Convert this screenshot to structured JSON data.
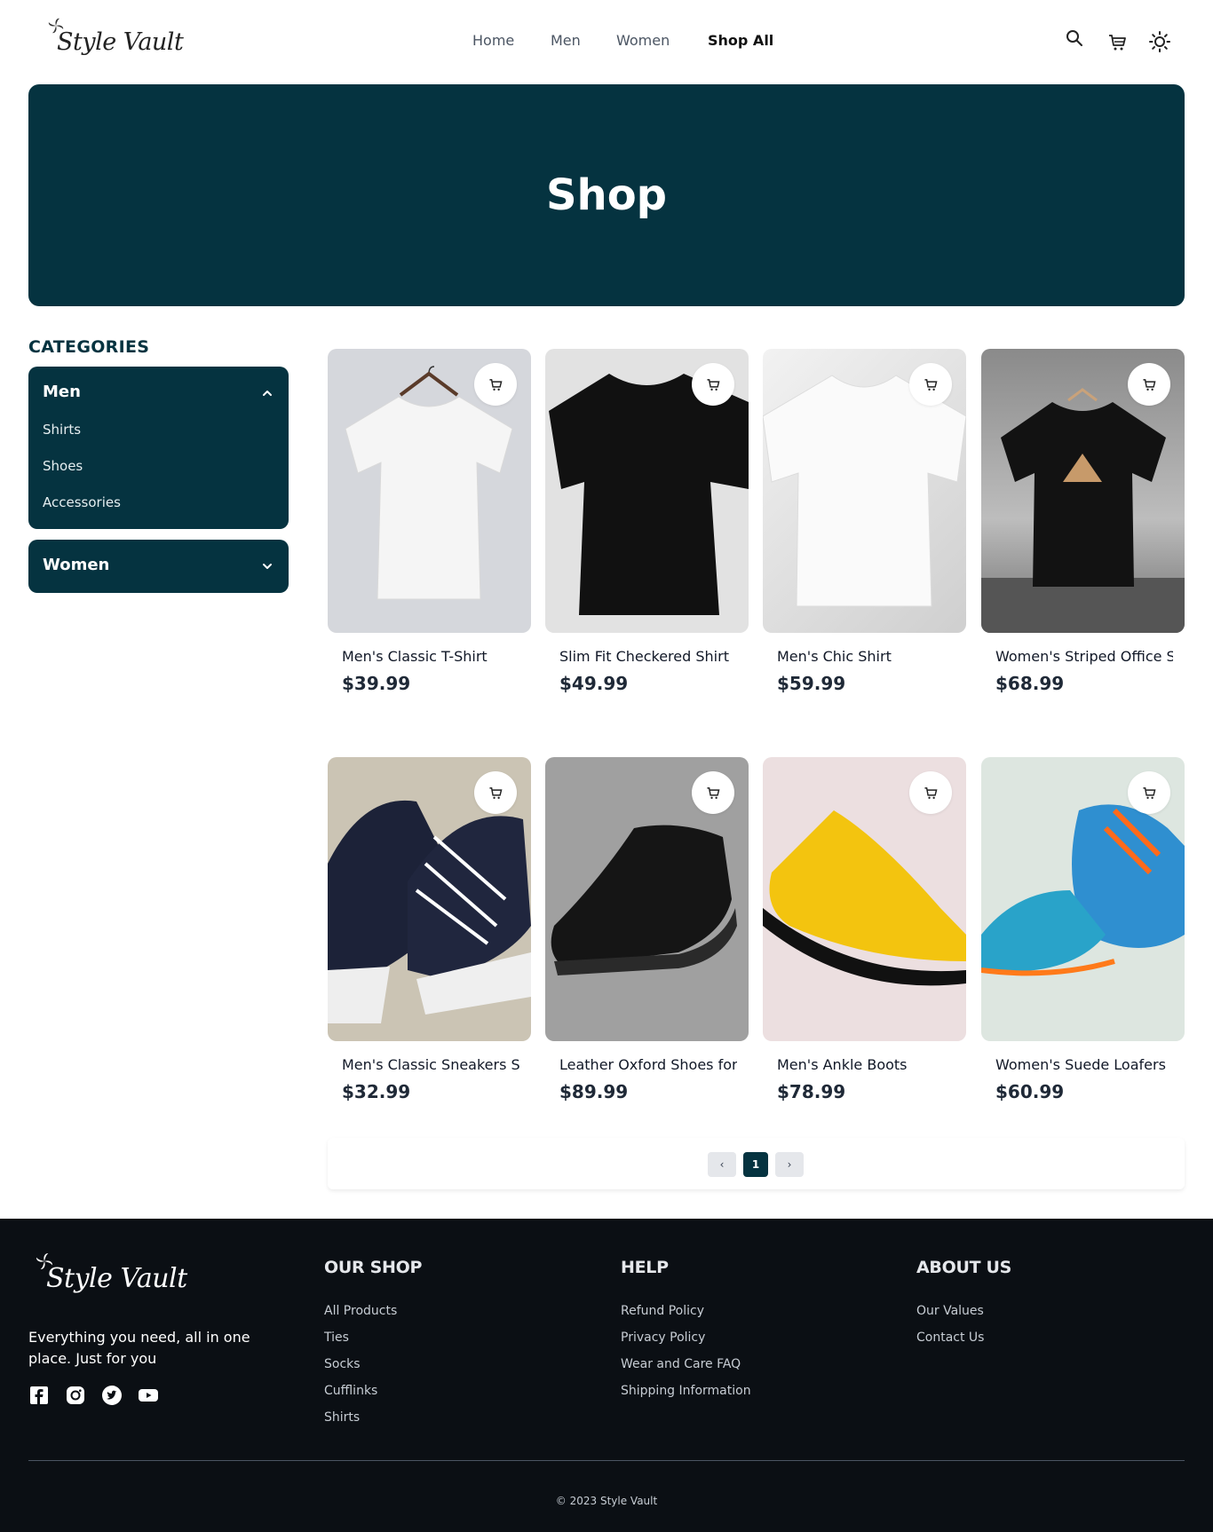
{
  "header": {
    "brand": "Style Vault",
    "nav": [
      {
        "label": "Home",
        "active": false
      },
      {
        "label": "Men",
        "active": false
      },
      {
        "label": "Women",
        "active": false
      },
      {
        "label": "Shop All",
        "active": true
      }
    ],
    "icons": [
      "search-icon",
      "cart-icon",
      "sun-icon"
    ]
  },
  "hero": {
    "title": "Shop"
  },
  "sidebar": {
    "title": "CATEGORIES",
    "men": {
      "label": "Men",
      "expanded": true,
      "items": [
        "Shirts",
        "Shoes",
        "Accessories"
      ]
    },
    "women": {
      "label": "Women",
      "expanded": false
    }
  },
  "products": [
    {
      "name": "Men's Classic T-Shirt",
      "price": "$39.99"
    },
    {
      "name": "Slim Fit Checkered Shirt",
      "price": "$49.99"
    },
    {
      "name": "Men's Chic Shirt",
      "price": "$59.99"
    },
    {
      "name": "Women's Striped Office Shirt",
      "price": "$68.99"
    },
    {
      "name": "Men's Classic Sneakers S",
      "price": "$32.99"
    },
    {
      "name": "Leather Oxford Shoes for",
      "price": "$89.99"
    },
    {
      "name": "Men's Ankle Boots",
      "price": "$78.99"
    },
    {
      "name": "Women's Suede Loafers",
      "price": "$60.99"
    }
  ],
  "pagination": {
    "prev": "‹",
    "current": "1",
    "next": "›"
  },
  "footer": {
    "brand": "Style Vault",
    "tagline": "Everything you need, all in one place. Just for you",
    "social": [
      "facebook-icon",
      "instagram-icon",
      "twitter-icon",
      "youtube-icon"
    ],
    "columns": [
      {
        "title": "OUR SHOP",
        "links": [
          "All Products",
          "Ties",
          "Socks",
          "Cufflinks",
          "Shirts"
        ]
      },
      {
        "title": "HELP",
        "links": [
          "Refund Policy",
          "Privacy Policy",
          "Wear and Care FAQ",
          "Shipping Information"
        ]
      },
      {
        "title": "ABOUT US",
        "links": [
          "Our Values",
          "Contact Us"
        ]
      }
    ],
    "copyright": "© 2023 Style Vault"
  },
  "colors": {
    "primary": "#053340",
    "footer_bg": "#0b0f14"
  }
}
